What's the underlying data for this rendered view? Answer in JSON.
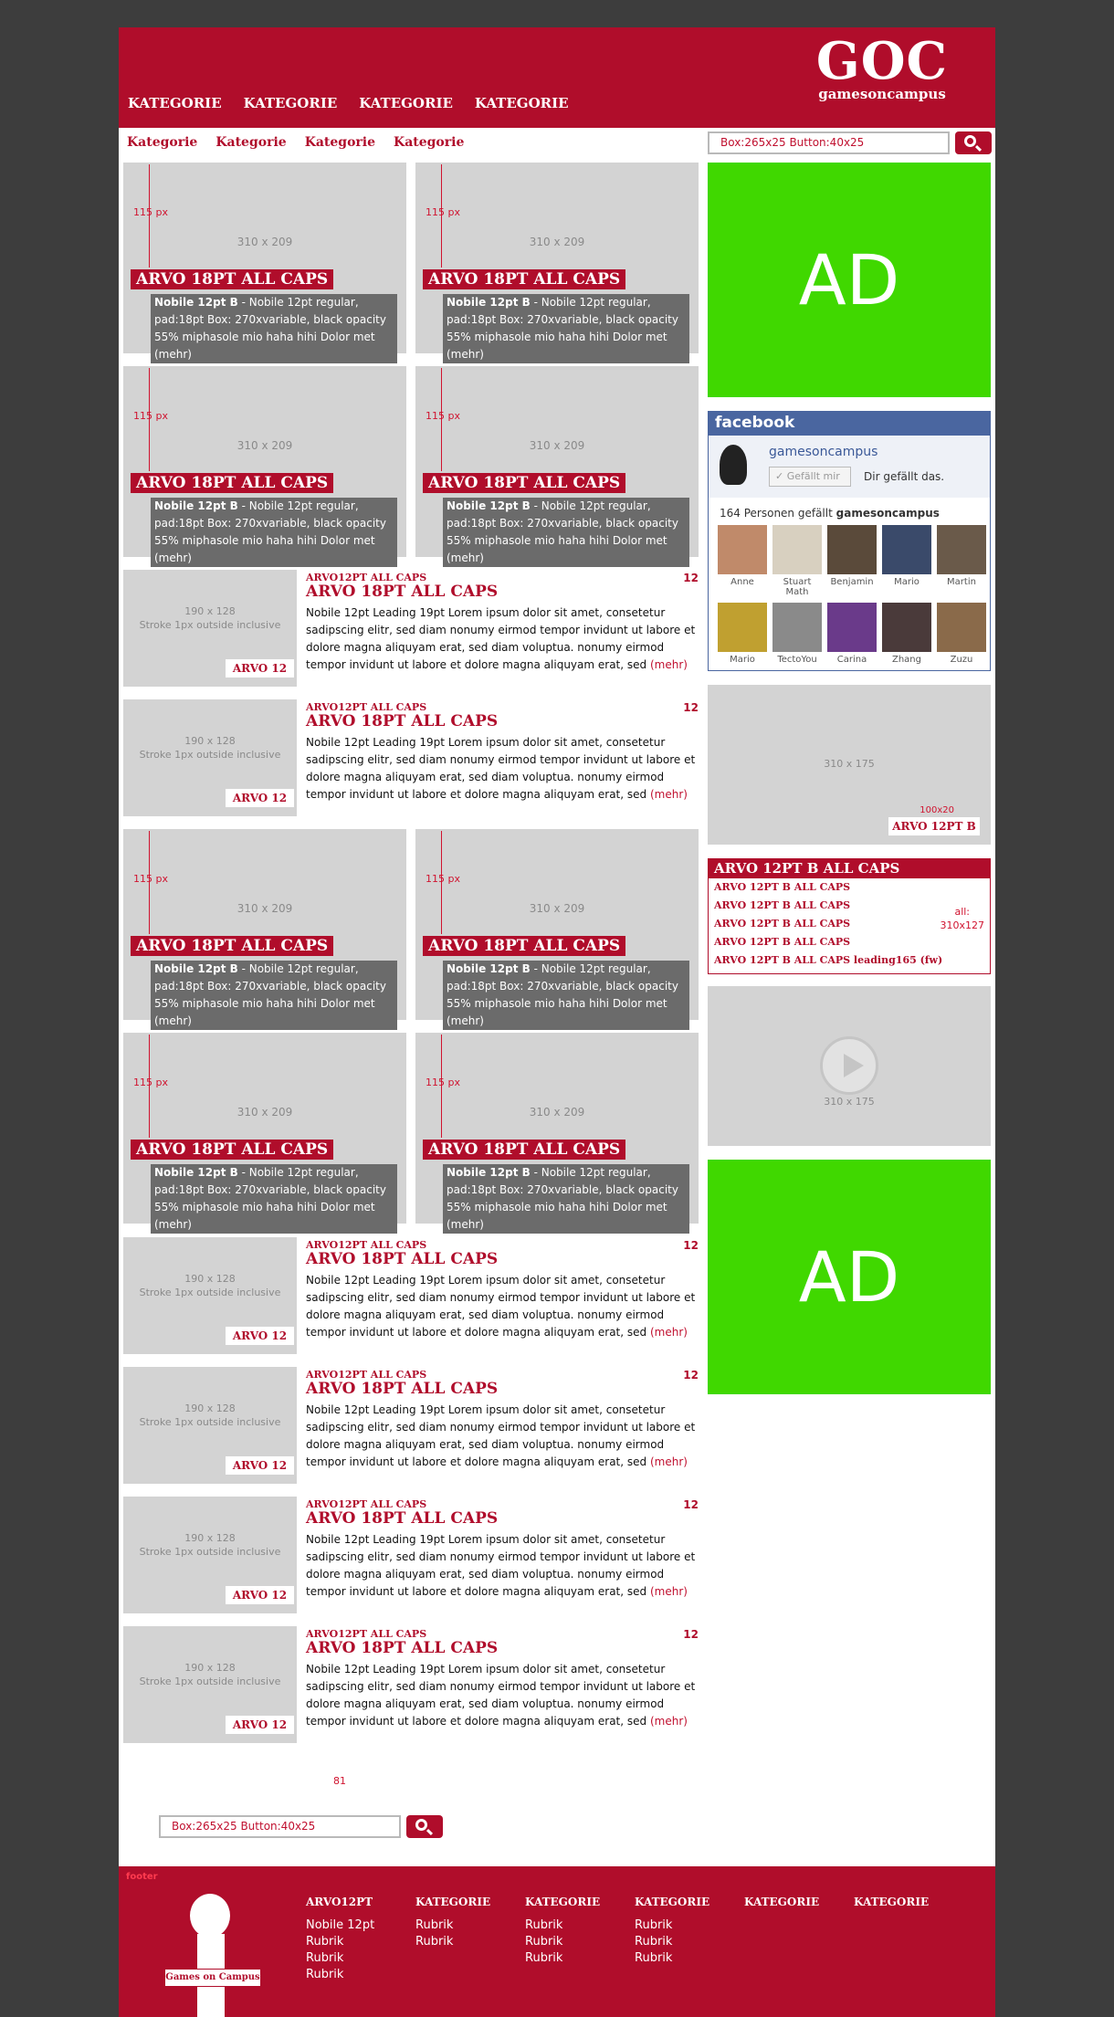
{
  "header": {
    "logo_big": "GOC",
    "logo_small": "gamesoncampus",
    "nav": [
      "KATEGORIE",
      "KATEGORIE",
      "KATEGORIE",
      "KATEGORIE"
    ]
  },
  "subnav": [
    "Kategorie",
    "Kategorie",
    "Kategorie",
    "Kategorie"
  ],
  "search_top": {
    "box": "Box:265x25   Button:40x25"
  },
  "search_bottom": {
    "box": "Box:265x25   Button:40x25"
  },
  "big_tile": {
    "px": "115 px",
    "dim": "310 x 209",
    "title": "ARVO 18PT ALL CAPS",
    "desc_bold": "Nobile 12pt B",
    "desc_rest": " - Nobile 12pt regular, pad:18pt Box: 270xvariable, black opacity 55% miphasole mio haha hihi Dolor met (mehr)"
  },
  "small_item": {
    "dim1": "190 x 128",
    "dim2": "Stroke 1px outside inclusive",
    "tag": "ARVO 12",
    "kicker": "ARVO12PT ALL CAPS",
    "title": "ARVO 18PT ALL CAPS",
    "text": "Nobile 12pt Leading 19pt   Lorem ipsum dolor sit amet, consetetur sadipscing elitr, sed diam nonumy eirmod tempor invidunt ut labore et dolore magna aliquyam erat, sed diam voluptua. nonumy eirmod tempor invidunt ut labore et dolore magna aliquyam erat, sed ",
    "more": "(mehr)",
    "count": "12"
  },
  "ad": "AD",
  "facebook": {
    "title": "facebook",
    "page_name": "gamesoncampus",
    "like_button": "✓ Gefällt mir",
    "liked": "Dir gefällt das.",
    "count_prefix": "164 Personen gefällt ",
    "count_name": "gamesoncampus",
    "faces": [
      {
        "name": "Anne",
        "color": "#c08a6a"
      },
      {
        "name": "Stuart Math",
        "color": "#d8d0c0"
      },
      {
        "name": "Benjamin",
        "color": "#5a4a3a"
      },
      {
        "name": "Mario",
        "color": "#3a4a6a"
      },
      {
        "name": "Martin",
        "color": "#6a5a4a"
      },
      {
        "name": "Mario",
        "color": "#c0a030"
      },
      {
        "name": "TectoYou",
        "color": "#8a8a8a"
      },
      {
        "name": "Carina",
        "color": "#6a3a8a"
      },
      {
        "name": "Zhang",
        "color": "#4a3a3a"
      },
      {
        "name": "Zuzu",
        "color": "#8a6a4a"
      }
    ]
  },
  "promo": {
    "dim": "310 x 175",
    "tag": "ARVO 12PT B",
    "size": "100x20"
  },
  "list": {
    "title": "ARVO 12PT B ALL CAPS",
    "items": [
      "ARVO 12PT B ALL CAPS",
      "ARVO 12PT B ALL CAPS",
      "ARVO 12PT B ALL CAPS",
      "ARVO 12PT B ALL CAPS",
      "ARVO 12PT B ALL CAPS leading165 (fw)"
    ],
    "note1": "all:",
    "note2": "310x127"
  },
  "video": {
    "dim": "310 x 175"
  },
  "pager_number": "81",
  "footer": {
    "tag": "footer",
    "mascot_sign": "Games on Campus",
    "columns": [
      {
        "head": "ARVO12PT",
        "links": [
          "Nobile 12pt",
          "Rubrik",
          "Rubrik",
          "Rubrik"
        ]
      },
      {
        "head": "KATEGORIE",
        "links": [
          "Rubrik",
          "Rubrik"
        ]
      },
      {
        "head": "KATEGORIE",
        "links": [
          "Rubrik",
          "Rubrik",
          "Rubrik"
        ]
      },
      {
        "head": "KATEGORIE",
        "links": [
          "Rubrik",
          "Rubrik",
          "Rubrik"
        ]
      },
      {
        "head": "KATEGORIE",
        "links": []
      },
      {
        "head": "KATEGORIE",
        "links": []
      }
    ]
  }
}
